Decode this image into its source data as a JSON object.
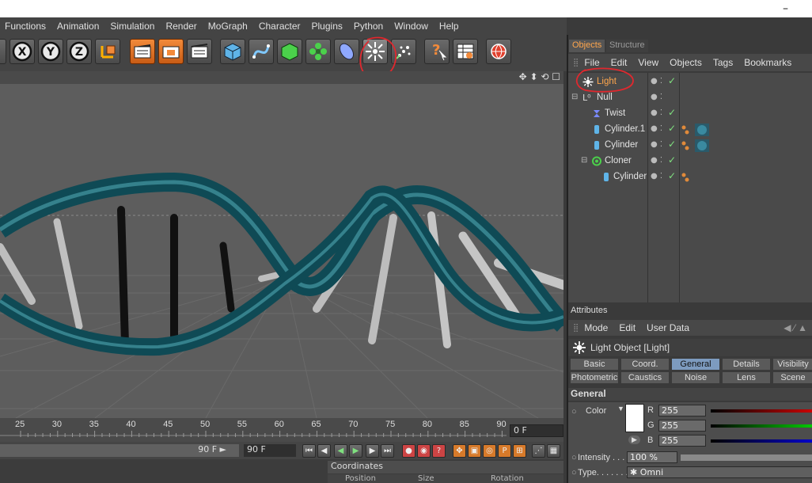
{
  "window": {
    "minimize": "–"
  },
  "menubar": {
    "items": [
      "Functions",
      "Animation",
      "Simulation",
      "Render",
      "MoGraph",
      "Character",
      "Plugins",
      "Python",
      "Window",
      "Help"
    ]
  },
  "toolbar": {
    "axis_x": "X",
    "axis_y": "Y",
    "axis_z": "Z",
    "help_glyph": "?",
    "highlight_color": "#e0282e"
  },
  "viewport": {
    "nav_icons": "✥ ⬍ ⟲ ☐"
  },
  "timeline": {
    "ticks": [
      "25",
      "30",
      "35",
      "40",
      "45",
      "50",
      "55",
      "60",
      "65",
      "70",
      "75",
      "80",
      "85",
      "90"
    ],
    "current_frame": "0 F",
    "end_frame": "90 F",
    "end_frame_field": "90 F",
    "end_frame_arrow": "►"
  },
  "coordinates": {
    "title": "Coordinates",
    "headers": [
      "Position",
      "Size",
      "Rotation"
    ]
  },
  "objects_panel": {
    "tabs": [
      "Objects",
      "Structure"
    ],
    "menu": [
      "File",
      "Edit",
      "View",
      "Objects",
      "Tags",
      "Bookmarks"
    ],
    "items": [
      {
        "name": "Light",
        "selected": true
      },
      {
        "name": "Null"
      },
      {
        "name": "Twist"
      },
      {
        "name": "Cylinder.1"
      },
      {
        "name": "Cylinder"
      },
      {
        "name": "Cloner"
      },
      {
        "name": "Cylinder"
      }
    ],
    "checkmark": "✓"
  },
  "attributes_panel": {
    "title": "Attributes",
    "menu": [
      "Mode",
      "Edit",
      "User Data"
    ],
    "object_label": "Light Object [Light]",
    "tabs_row1": [
      "Basic",
      "Coord.",
      "General",
      "Details",
      "Visibility"
    ],
    "tabs_row2": [
      "Photometric",
      "Caustics",
      "Noise",
      "Lens",
      "Scene"
    ],
    "active_tab": "General",
    "section": "General",
    "color_label": "Color",
    "r_label": "R",
    "r_value": "255",
    "g_label": "G",
    "g_value": "255",
    "b_label": "B",
    "b_value": "255",
    "intensity_label": "Intensity . . .",
    "intensity_value": "100 %",
    "type_label": "Type. . . . . . .",
    "type_value": "Omni"
  }
}
